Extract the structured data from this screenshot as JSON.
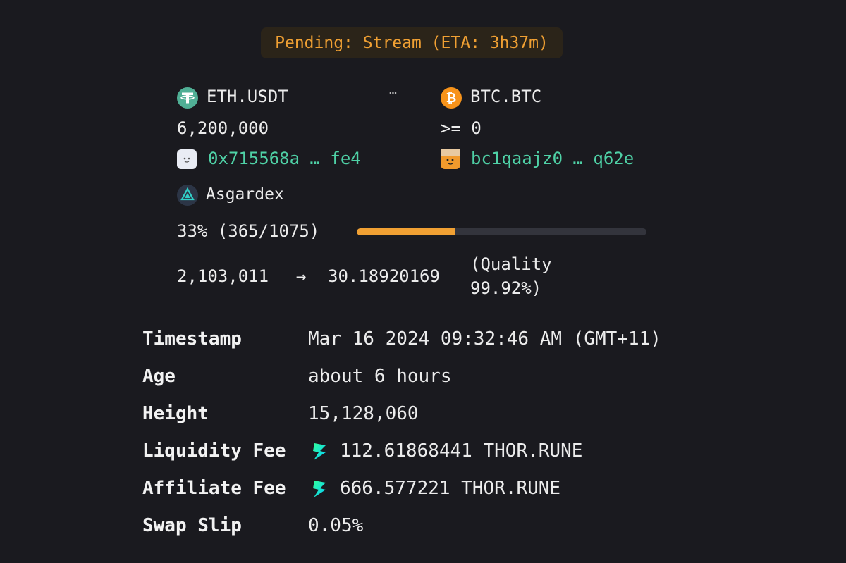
{
  "status": {
    "badge": "Pending: Stream (ETA: 3h37m)"
  },
  "swap": {
    "from_asset": "ETH.USDT",
    "from_amount": "6,200,000",
    "from_address": "0x715568a … fe4",
    "separator": "⋯",
    "to_asset": "BTC.BTC",
    "to_amount": ">= 0",
    "to_address": "bc1qaajz0 … q62e",
    "interface": "Asgardex"
  },
  "stream": {
    "progress_text": "33% (365/1075)",
    "progress_fraction": 0.3395,
    "input_amount": "2,103,011",
    "arrow": "→",
    "output_amount": "30.18920169",
    "quality_line1": "(Quality",
    "quality_line2": "99.92%)"
  },
  "details": {
    "timestamp_label": "Timestamp",
    "timestamp_value": "Mar 16 2024 09:32:46 AM (GMT+11)",
    "age_label": "Age",
    "age_value": "about 6 hours",
    "height_label": "Height",
    "height_value": "15,128,060",
    "liquidity_fee_label": "Liquidity Fee",
    "liquidity_fee_value": "112.61868441 THOR.RUNE",
    "affiliate_fee_label": "Affiliate Fee",
    "affiliate_fee_value": "666.577221 THOR.RUNE",
    "swap_slip_label": "Swap Slip",
    "swap_slip_value": "0.05%"
  },
  "colors": {
    "background": "#1a1a1f",
    "accent_orange": "#f0a033",
    "accent_green": "#4fd1a6",
    "usdt_green": "#50af95",
    "btc_orange": "#f7931a"
  },
  "icons": {
    "usdt": "usdt-coin-icon",
    "btc": "btc-coin-icon",
    "from_avatar": "wallet-avatar-icon",
    "to_avatar": "wallet-avatar-icon",
    "asgardex": "asgardex-logo-icon",
    "rune": "rune-bolt-icon"
  }
}
